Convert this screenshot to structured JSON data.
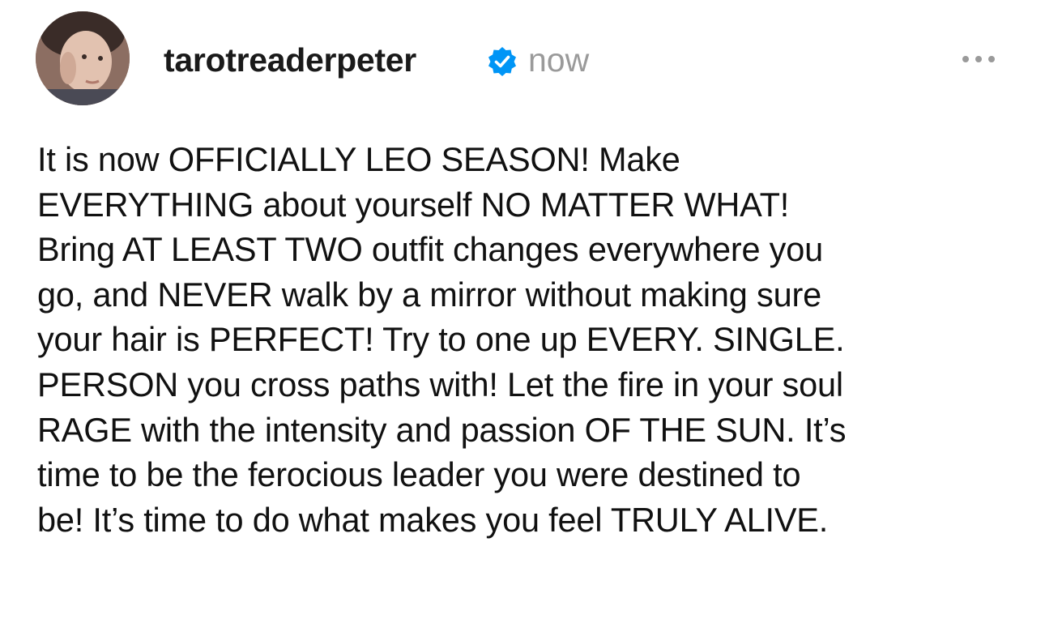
{
  "post": {
    "username": "tarotreaderpeter",
    "timestamp": "now",
    "verified": true,
    "more_icon": "more-horizontal-icon",
    "accent_color": "#0095f6",
    "body_lines": [
      "It is now OFFICIALLY LEO SEASON! Make",
      "EVERYTHING about yourself NO MATTER WHAT!",
      "Bring AT LEAST TWO outfit changes everywhere you",
      "go, and NEVER walk by a mirror without making sure",
      "your hair is PERFECT! Try to one up EVERY. SINGLE.",
      "PERSON you cross paths with! Let the fire in your soul",
      "RAGE with the intensity and passion OF THE SUN. It’s",
      "time to be the ferocious leader you were destined to",
      "be! It’s time to do what makes you feel TRULY ALIVE."
    ]
  }
}
